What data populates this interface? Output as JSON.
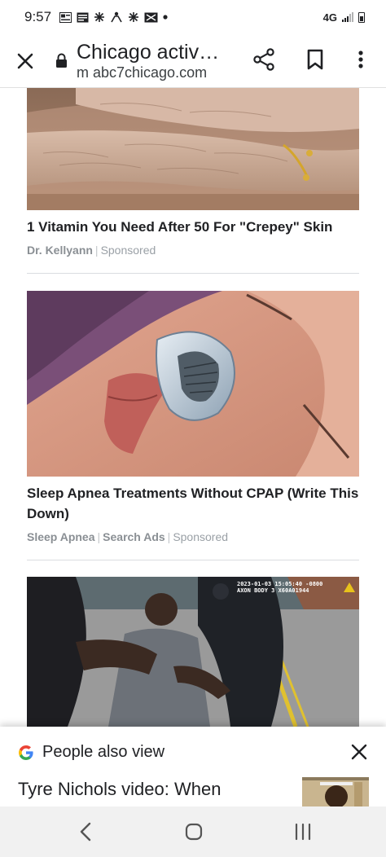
{
  "status_bar": {
    "time": "9:57",
    "network": "4G",
    "icons": [
      "news-icon",
      "news-icon",
      "pinwheel-icon",
      "game-icon",
      "pinwheel-icon",
      "news-icon",
      "dot-icon"
    ]
  },
  "toolbar": {
    "title": "Chicago activ…",
    "url": "m abc7chicago.com"
  },
  "ads": [
    {
      "title": "1 Vitamin You Need After 50 For \"Crepey\" Skin",
      "sources": [
        "Dr. Kellyann"
      ],
      "sponsored": "Sponsored"
    },
    {
      "title": "Sleep Apnea Treatments Without CPAP (Write This Down)",
      "sources": [
        "Sleep Apnea",
        "Search Ads"
      ],
      "sponsored": "Sponsored"
    }
  ],
  "video_card": {
    "stamp_line1": "2023-01-03 15:05:40 -0800",
    "stamp_line2": "AXON BODY 3 X60A01944"
  },
  "sheet": {
    "title": "People also view",
    "item": "Tyre Nichols video: When"
  },
  "colors": {
    "text": "#202124",
    "meta": "#9aa0a6",
    "divider": "#dadce0",
    "google_blue": "#4285F4",
    "google_red": "#EA4335",
    "google_yellow": "#FBBC05",
    "google_green": "#34A853",
    "nav_bg": "#f1f1f1"
  }
}
